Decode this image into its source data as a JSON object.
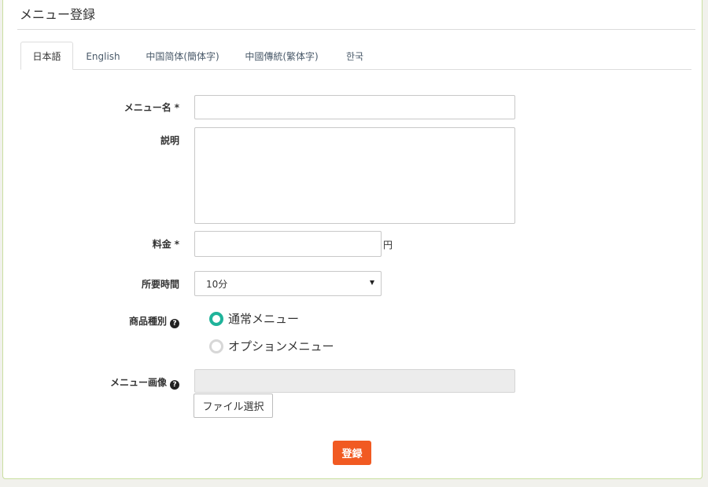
{
  "page": {
    "title": "メニュー登録"
  },
  "tabs": [
    {
      "label": "日本語",
      "active": true
    },
    {
      "label": "English",
      "active": false
    },
    {
      "label": "中国简体(簡体字)",
      "active": false
    },
    {
      "label": "中國傳統(繁体字)",
      "active": false
    },
    {
      "label": "한국",
      "active": false
    }
  ],
  "form": {
    "menu_name": {
      "label": "メニュー名",
      "required_mark": "*",
      "value": ""
    },
    "description": {
      "label": "説明",
      "value": ""
    },
    "price": {
      "label": "料金",
      "required_mark": "*",
      "value": "",
      "unit": "円"
    },
    "duration": {
      "label": "所要時間",
      "selected": "10分"
    },
    "product_type": {
      "label": "商品種別",
      "help_icon": "question-circle-icon",
      "options": [
        {
          "label": "通常メニュー",
          "checked": true
        },
        {
          "label": "オプションメニュー",
          "checked": false
        }
      ]
    },
    "menu_image": {
      "label": "メニュー画像",
      "help_icon": "question-circle-icon",
      "file_button": "ファイル選択"
    },
    "submit_label": "登録"
  },
  "colors": {
    "submit": "#f15a22",
    "radio_checked": "#1fb39a",
    "panel_border": "#c9dfa0"
  }
}
